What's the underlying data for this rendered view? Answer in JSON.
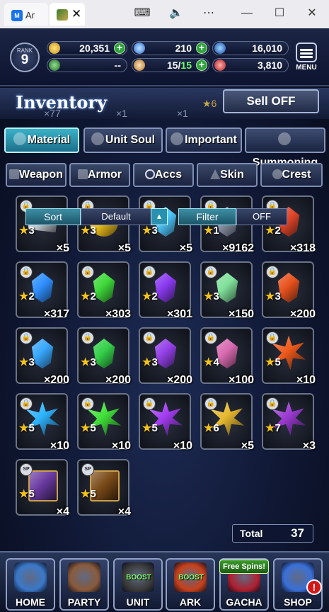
{
  "window": {
    "tab1_label": "Ar",
    "app_badge": "M"
  },
  "status": {
    "rank_label": "RANK",
    "rank": "9",
    "gold": "20,351",
    "gems": "210",
    "orbs": "16,010",
    "stamina": "--",
    "trials": "15/15",
    "trials_current": "15/",
    "trials_max": "15",
    "crystals": "3,810",
    "menu_label": "MENU"
  },
  "inventory": {
    "title": "Inventory",
    "sell_label": "Sell OFF",
    "ghost_counts": [
      "×77",
      "×1",
      "×1"
    ],
    "ghost_star": "★6"
  },
  "tabs": [
    {
      "label": "Material",
      "active": true,
      "icon": "bag-icon"
    },
    {
      "label": "Unit Soul",
      "active": false,
      "icon": "soul-icon"
    },
    {
      "label": "Important",
      "active": false,
      "icon": "star-icon"
    },
    {
      "label": "Summoning",
      "active": false,
      "icon": "summon-icon"
    }
  ],
  "subtabs": [
    {
      "label": "Weapon",
      "icon": "sword-icon"
    },
    {
      "label": "Armor",
      "icon": "armor-icon"
    },
    {
      "label": "Accs",
      "icon": "ring-icon"
    },
    {
      "label": "Skin",
      "icon": "hanger-icon"
    },
    {
      "label": "Crest",
      "icon": "crest-icon"
    }
  ],
  "sortbar": {
    "sort_label": "Sort",
    "sort_value": "Default",
    "filter_label": "Filter",
    "filter_value": "OFF"
  },
  "items": [
    {
      "rarity": "3",
      "count": "×5",
      "color": "#c9ced8",
      "shape": "paper"
    },
    {
      "rarity": "3",
      "count": "×5",
      "color": "#f2c21c",
      "shape": "ball"
    },
    {
      "rarity": "3",
      "count": "×5",
      "color": "#4fc8ff",
      "shape": "gem"
    },
    {
      "rarity": "1",
      "count": "×9162",
      "color": "#8c95a8",
      "shape": "gem"
    },
    {
      "rarity": "2",
      "count": "×318",
      "color": "#e0452a",
      "shape": "gem"
    },
    {
      "rarity": "2",
      "count": "×317",
      "color": "#2f8fff",
      "shape": "gem"
    },
    {
      "rarity": "2",
      "count": "×303",
      "color": "#3fd83a",
      "shape": "gem"
    },
    {
      "rarity": "2",
      "count": "×301",
      "color": "#8a3af0",
      "shape": "gem"
    },
    {
      "rarity": "3",
      "count": "×150",
      "color": "#7fe09a",
      "shape": "gem"
    },
    {
      "rarity": "3",
      "count": "×200",
      "color": "#e8521e",
      "shape": "gem"
    },
    {
      "rarity": "3",
      "count": "×200",
      "color": "#39a8ff",
      "shape": "gem"
    },
    {
      "rarity": "3",
      "count": "×200",
      "color": "#35d04a",
      "shape": "gem"
    },
    {
      "rarity": "3",
      "count": "×200",
      "color": "#9440e8",
      "shape": "gem"
    },
    {
      "rarity": "4",
      "count": "×100",
      "color": "#d86ab0",
      "shape": "gem"
    },
    {
      "rarity": "5",
      "count": "×10",
      "color": "#ef5a1c",
      "shape": "burst"
    },
    {
      "rarity": "5",
      "count": "×10",
      "color": "#2fb4ff",
      "shape": "burst"
    },
    {
      "rarity": "5",
      "count": "×10",
      "color": "#42e03a",
      "shape": "burst"
    },
    {
      "rarity": "5",
      "count": "×10",
      "color": "#a23cf0",
      "shape": "burst"
    },
    {
      "rarity": "6",
      "count": "×5",
      "color": "#e6b830",
      "shape": "burst"
    },
    {
      "rarity": "7",
      "count": "×3",
      "color": "#9a3ad0",
      "shape": "burst"
    },
    {
      "rarity": "5",
      "count": "×4",
      "color": "#6a3aa0",
      "shape": "book",
      "special": true
    },
    {
      "rarity": "5",
      "count": "×4",
      "color": "#7a4a18",
      "shape": "book",
      "special": true
    }
  ],
  "lock_glyph": "🔒",
  "special_glyph": "SP",
  "total": {
    "label": "Total",
    "value": "37"
  },
  "nav": [
    {
      "label": "HOME",
      "color": "#3a78c8"
    },
    {
      "label": "PARTY",
      "color": "#8a5a3a"
    },
    {
      "label": "UNIT",
      "color": "#3a3a3a",
      "boost": "BOOST"
    },
    {
      "label": "ARK",
      "color": "#c8401a",
      "boost": "BOOST"
    },
    {
      "label": "GACHA",
      "color": "#b02030",
      "free": "Free Spins!"
    },
    {
      "label": "SHOP",
      "color": "#3a70d8"
    }
  ],
  "shop_badge": "!"
}
